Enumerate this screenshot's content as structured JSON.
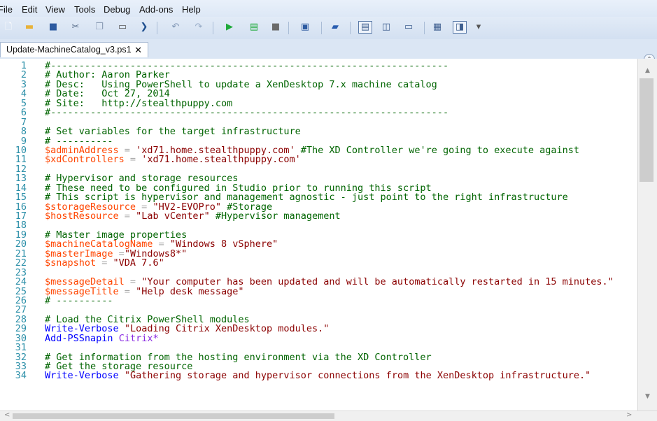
{
  "menu": [
    "File",
    "Edit",
    "View",
    "Tools",
    "Debug",
    "Add-ons",
    "Help"
  ],
  "toolbar": {
    "buttons": [
      {
        "name": "new-file-icon",
        "glyph": "🗋",
        "color": "#ffffff"
      },
      {
        "name": "open-folder-icon",
        "glyph": "▬",
        "color": "#e8b23a"
      },
      {
        "name": "save-icon",
        "glyph": "■",
        "color": "#2c5aa0"
      },
      {
        "name": "cut-icon",
        "glyph": "✂",
        "color": "#5a6f8c"
      },
      {
        "name": "copy-icon",
        "glyph": "❐",
        "color": "#8a9bb4"
      },
      {
        "name": "paste-icon",
        "glyph": "▭",
        "color": "#555555"
      },
      {
        "name": "clear-console-icon",
        "glyph": "❯",
        "color": "#1f4f8f"
      },
      {
        "name": "undo-icon",
        "glyph": "↶",
        "color": "#7f95b5"
      },
      {
        "name": "redo-icon",
        "glyph": "↷",
        "color": "#9aaec9"
      },
      {
        "name": "run-script-icon",
        "glyph": "▶",
        "color": "#1faa3a"
      },
      {
        "name": "run-selection-icon",
        "glyph": "▤",
        "color": "#1faa3a"
      },
      {
        "name": "stop-icon",
        "glyph": "■",
        "color": "#6a6a6a"
      },
      {
        "name": "remote-powershell-icon",
        "glyph": "▣",
        "color": "#2c5aa0"
      },
      {
        "name": "powershell-icon",
        "glyph": "▰",
        "color": "#2a5db0"
      },
      {
        "name": "show-script-pane-top-icon",
        "glyph": "▤",
        "color": "#3f5f8f"
      },
      {
        "name": "show-script-pane-right-icon",
        "glyph": "◫",
        "color": "#3f5f8f"
      },
      {
        "name": "show-script-pane-maximized-icon",
        "glyph": "▭",
        "color": "#3f5f8f"
      },
      {
        "name": "show-command-window-icon",
        "glyph": "▦",
        "color": "#3f5f8f"
      },
      {
        "name": "show-command-addon-icon",
        "glyph": "◨",
        "color": "#3f5f8f"
      },
      {
        "name": "toolbar-overflow-icon",
        "glyph": "▾",
        "color": "#555555"
      }
    ]
  },
  "tab": {
    "title": "Update-MachineCatalog_v3.ps1",
    "close": "✕"
  },
  "colors": {
    "comment": "#006400",
    "variable": "#ff4500",
    "operator": "#a9a9a9",
    "string": "#8b0000",
    "command": "#0000ff",
    "argument": "#8a2be2",
    "line_number": "#2b8fa8"
  },
  "editor": {
    "lines": [
      {
        "n": "1",
        "tokens": [
          {
            "t": "c",
            "v": "#----------------------------------------------------------------------"
          }
        ]
      },
      {
        "n": "2",
        "tokens": [
          {
            "t": "c",
            "v": "# Author: Aaron Parker"
          }
        ]
      },
      {
        "n": "3",
        "tokens": [
          {
            "t": "c",
            "v": "# Desc:   Using PowerShell to update a XenDesktop 7.x machine catalog"
          }
        ]
      },
      {
        "n": "4",
        "tokens": [
          {
            "t": "c",
            "v": "# Date:   Oct 27, 2014"
          }
        ]
      },
      {
        "n": "5",
        "tokens": [
          {
            "t": "c",
            "v": "# Site:   http://stealthpuppy.com"
          }
        ]
      },
      {
        "n": "6",
        "tokens": [
          {
            "t": "c",
            "v": "#----------------------------------------------------------------------"
          }
        ]
      },
      {
        "n": "7",
        "tokens": []
      },
      {
        "n": "8",
        "tokens": [
          {
            "t": "c",
            "v": "# Set variables for the target infrastructure"
          }
        ]
      },
      {
        "n": "9",
        "tokens": [
          {
            "t": "c",
            "v": "# ----------"
          }
        ]
      },
      {
        "n": "10",
        "tokens": [
          {
            "t": "v",
            "v": "$adminAddress"
          },
          {
            "t": "o",
            "v": " = "
          },
          {
            "t": "s",
            "v": "'xd71.home.stealthpuppy.com'"
          },
          {
            "t": "c",
            "v": " #The XD Controller we're going to execute against"
          }
        ]
      },
      {
        "n": "11",
        "tokens": [
          {
            "t": "v",
            "v": "$xdControllers"
          },
          {
            "t": "o",
            "v": " = "
          },
          {
            "t": "s",
            "v": "'xd71.home.stealthpuppy.com'"
          }
        ]
      },
      {
        "n": "12",
        "tokens": []
      },
      {
        "n": "13",
        "tokens": [
          {
            "t": "c",
            "v": "# Hypervisor and storage resources"
          }
        ]
      },
      {
        "n": "14",
        "tokens": [
          {
            "t": "c",
            "v": "# These need to be configured in Studio prior to running this script"
          }
        ]
      },
      {
        "n": "15",
        "tokens": [
          {
            "t": "c",
            "v": "# This script is hypervisor and management agnostic - just point to the right infrastructure"
          }
        ]
      },
      {
        "n": "16",
        "tokens": [
          {
            "t": "v",
            "v": "$storageResource"
          },
          {
            "t": "o",
            "v": " = "
          },
          {
            "t": "s",
            "v": "\"HV2-EVOPro\""
          },
          {
            "t": "c",
            "v": " #Storage"
          }
        ]
      },
      {
        "n": "17",
        "tokens": [
          {
            "t": "v",
            "v": "$hostResource"
          },
          {
            "t": "o",
            "v": " = "
          },
          {
            "t": "s",
            "v": "\"Lab vCenter\""
          },
          {
            "t": "c",
            "v": " #Hypervisor management"
          }
        ]
      },
      {
        "n": "18",
        "tokens": []
      },
      {
        "n": "19",
        "tokens": [
          {
            "t": "c",
            "v": "# Master image properties"
          }
        ]
      },
      {
        "n": "20",
        "tokens": [
          {
            "t": "v",
            "v": "$machineCatalogName"
          },
          {
            "t": "o",
            "v": " = "
          },
          {
            "t": "s",
            "v": "\"Windows 8 vSphere\""
          }
        ]
      },
      {
        "n": "21",
        "tokens": [
          {
            "t": "v",
            "v": "$masterImage"
          },
          {
            "t": "o",
            "v": " ="
          },
          {
            "t": "s",
            "v": "\"Windows8*\""
          }
        ]
      },
      {
        "n": "22",
        "tokens": [
          {
            "t": "v",
            "v": "$snapshot"
          },
          {
            "t": "o",
            "v": " = "
          },
          {
            "t": "s",
            "v": "\"VDA 7.6\""
          }
        ]
      },
      {
        "n": "23",
        "tokens": []
      },
      {
        "n": "24",
        "tokens": [
          {
            "t": "v",
            "v": "$messageDetail"
          },
          {
            "t": "o",
            "v": " = "
          },
          {
            "t": "s",
            "v": "\"Your computer has been updated and will be automatically restarted in 15 minutes.\""
          }
        ]
      },
      {
        "n": "25",
        "tokens": [
          {
            "t": "v",
            "v": "$messageTitle"
          },
          {
            "t": "o",
            "v": " = "
          },
          {
            "t": "s",
            "v": "\"Help desk message\""
          }
        ]
      },
      {
        "n": "26",
        "tokens": [
          {
            "t": "c",
            "v": "# ----------"
          }
        ]
      },
      {
        "n": "27",
        "tokens": []
      },
      {
        "n": "28",
        "tokens": [
          {
            "t": "c",
            "v": "# Load the Citrix PowerShell modules"
          }
        ]
      },
      {
        "n": "29",
        "tokens": [
          {
            "t": "k",
            "v": "Write-Verbose"
          },
          {
            "t": "p",
            "v": " "
          },
          {
            "t": "s",
            "v": "\"Loading Citrix XenDesktop modules.\""
          }
        ]
      },
      {
        "n": "30",
        "tokens": [
          {
            "t": "k",
            "v": "Add-PSSnapin"
          },
          {
            "t": "p",
            "v": " "
          },
          {
            "t": "a",
            "v": "Citrix*"
          }
        ]
      },
      {
        "n": "31",
        "tokens": []
      },
      {
        "n": "32",
        "tokens": [
          {
            "t": "c",
            "v": "# Get information from the hosting environment via the XD Controller"
          }
        ]
      },
      {
        "n": "33",
        "tokens": [
          {
            "t": "c",
            "v": "# Get the storage resource"
          }
        ]
      },
      {
        "n": "34",
        "tokens": [
          {
            "t": "k",
            "v": "Write-Verbose"
          },
          {
            "t": "p",
            "v": " "
          },
          {
            "t": "s",
            "v": "\"Gathering storage and hypervisor connections from the XenDesktop infrastructure.\""
          }
        ]
      }
    ]
  },
  "scrollbars": {
    "up": "▲",
    "down": "▼",
    "left": "<",
    "right": ">"
  },
  "collapse_glyph": "⌃"
}
